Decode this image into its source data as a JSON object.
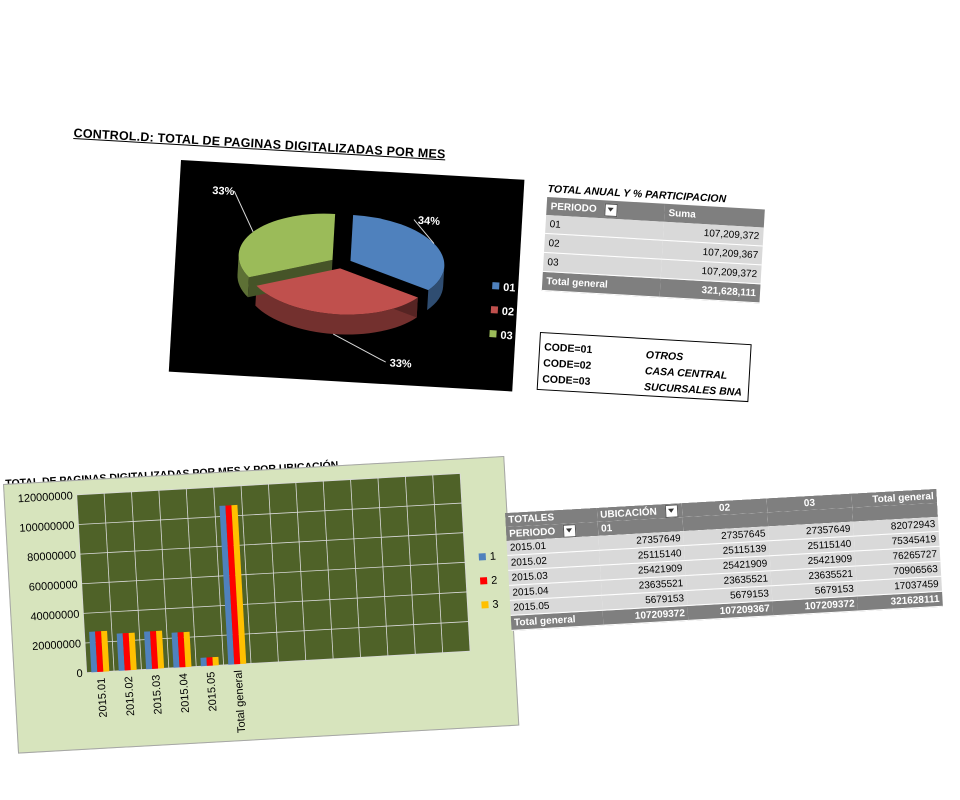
{
  "page_title": "CONTROL.D: TOTAL DE PAGINAS DIGITALIZADAS POR MES",
  "bar_section_title": "TOTAL DE PAGINAS DIGITALIZADAS POR MES Y POR UBICACIÓN",
  "summary": {
    "title": "TOTAL ANUAL Y % PARTICIPACION",
    "header_periodo": "PERIODO",
    "header_suma": "Suma",
    "rows": [
      {
        "periodo": "01",
        "suma": "107,209,372"
      },
      {
        "periodo": "02",
        "suma": "107,209,367"
      },
      {
        "periodo": "03",
        "suma": "107,209,372"
      }
    ],
    "total_label": "Total general",
    "total_value": "321,628,111"
  },
  "codes": [
    {
      "code": "CODE=01",
      "desc": "OTROS"
    },
    {
      "code": "CODE=02",
      "desc": "CASA CENTRAL"
    },
    {
      "code": "CODE=03",
      "desc": "SUCURSALES BNA"
    }
  ],
  "pivot": {
    "label_totales": "TOTALES",
    "label_ubicacion": "UBICACIÓN",
    "label_periodo": "PERIODO",
    "columns": [
      "01",
      "02",
      "03",
      "Total general"
    ],
    "rows": [
      {
        "periodo": "2015.01",
        "values": [
          "27357649",
          "27357645",
          "27357649",
          "82072943"
        ]
      },
      {
        "periodo": "2015.02",
        "values": [
          "25115140",
          "25115139",
          "25115140",
          "75345419"
        ]
      },
      {
        "periodo": "2015.03",
        "values": [
          "25421909",
          "25421909",
          "25421909",
          "76265727"
        ]
      },
      {
        "periodo": "2015.04",
        "values": [
          "23635521",
          "23635521",
          "23635521",
          "70906563"
        ]
      },
      {
        "periodo": "2015.05",
        "values": [
          "5679153",
          "5679153",
          "5679153",
          "17037459"
        ]
      }
    ],
    "total_label": "Total general",
    "total_values": [
      "107209372",
      "107209367",
      "107209372",
      "321628111"
    ]
  },
  "chart_data": [
    {
      "type": "pie",
      "labels": [
        "01",
        "02",
        "03"
      ],
      "values": [
        34,
        33,
        33
      ],
      "data_labels": [
        "34%",
        "33%",
        "33%"
      ],
      "colors": [
        "#4f81bd",
        "#c0504d",
        "#9bbb59"
      ],
      "legend_position": "right",
      "background": "#000000"
    },
    {
      "type": "bar",
      "categories": [
        "2015.01",
        "2015.02",
        "2015.03",
        "2015.04",
        "2015.05",
        "Total general"
      ],
      "series": [
        {
          "name": "1",
          "values": [
            27357649,
            25115140,
            25421909,
            23635521,
            5679153,
            107209372
          ],
          "color": "#4f81bd"
        },
        {
          "name": "2",
          "values": [
            27357645,
            25115139,
            25421909,
            23635521,
            5679153,
            107209367
          ],
          "color": "#ff0000"
        },
        {
          "name": "3",
          "values": [
            27357649,
            25115140,
            25421909,
            23635521,
            5679153,
            107209372
          ],
          "color": "#ffc000"
        }
      ],
      "ylim": [
        0,
        120000000
      ],
      "yticks": [
        "0",
        "20000000",
        "40000000",
        "60000000",
        "80000000",
        "100000000",
        "120000000"
      ],
      "grid": true,
      "legend_position": "right",
      "plot_background": "#4f6228",
      "chart_background": "#d7e4bd"
    }
  ]
}
